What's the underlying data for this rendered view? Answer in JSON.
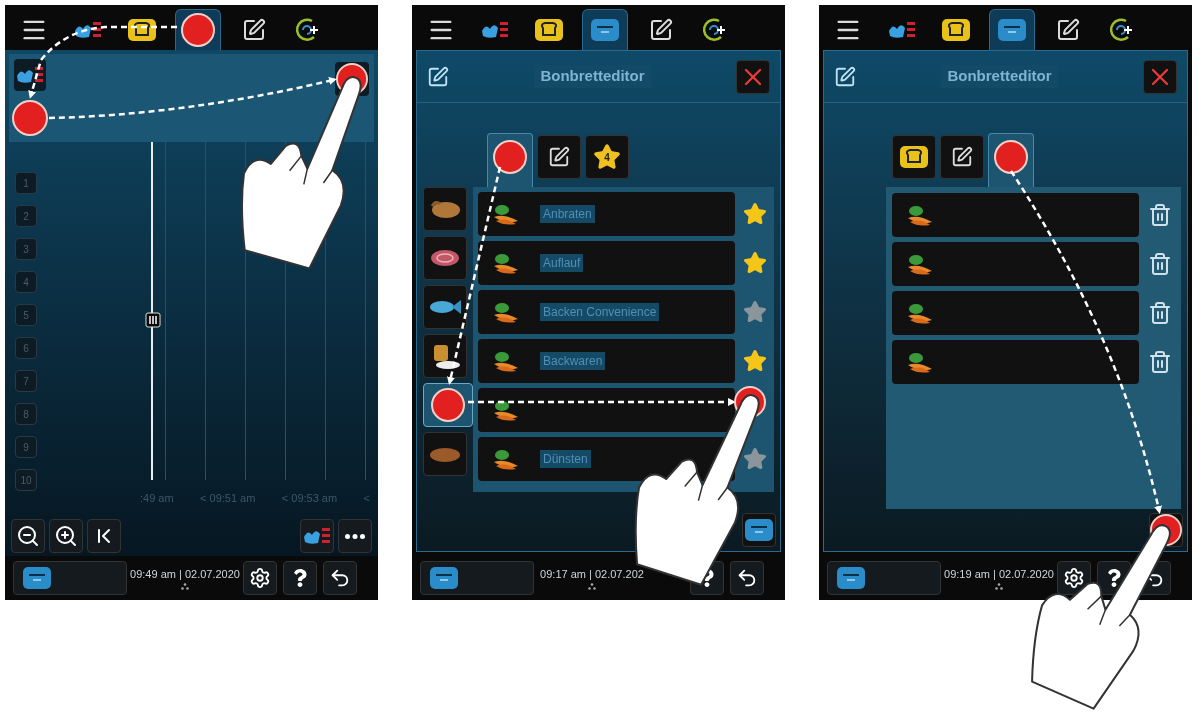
{
  "screens": [
    {
      "kind": "timeline",
      "top_tabs": [
        {
          "kind": "menu",
          "selected": false
        },
        {
          "kind": "pathway",
          "selected": false
        },
        {
          "kind": "bread",
          "selected": false
        },
        {
          "kind": "marked",
          "selected": true
        },
        {
          "kind": "edit",
          "selected": false
        },
        {
          "kind": "plus",
          "selected": false
        }
      ],
      "lanes": [
        "1",
        "2",
        "3",
        "4",
        "5",
        "6",
        "7",
        "8",
        "9",
        "10"
      ],
      "time_labels": [
        ":49 am",
        "< 09:51 am",
        "< 09:53 am",
        "<"
      ],
      "status": {
        "time": "09:49 am",
        "separator": "|",
        "date": "02.07.2020"
      }
    },
    {
      "kind": "editor",
      "top_tabs": [
        {
          "kind": "menu",
          "selected": false
        },
        {
          "kind": "pathway",
          "selected": false
        },
        {
          "kind": "bread",
          "selected": false
        },
        {
          "kind": "board",
          "selected": true
        },
        {
          "kind": "edit",
          "selected": false
        },
        {
          "kind": "plus",
          "selected": false
        }
      ],
      "title": "Bonbretteditor",
      "tabs": [
        {
          "kind": "marked",
          "selected": true
        },
        {
          "kind": "edit",
          "selected": false
        },
        {
          "kind": "favorites",
          "count": "4",
          "selected": false
        }
      ],
      "categories": [
        {
          "kind": "poultry",
          "selected": false
        },
        {
          "kind": "meat",
          "selected": false
        },
        {
          "kind": "fish",
          "selected": false
        },
        {
          "kind": "dessert",
          "selected": false
        },
        {
          "kind": "marked",
          "selected": true
        },
        {
          "kind": "bread",
          "selected": false
        }
      ],
      "rows": [
        {
          "label": "Anbraten",
          "favorite": true
        },
        {
          "label": "Auflauf",
          "favorite": true
        },
        {
          "label": "Backen Convenience",
          "favorite": false
        },
        {
          "label": "Backwaren",
          "favorite": true
        },
        {},
        {
          "label": "Dünsten",
          "favorite": false
        }
      ],
      "status": {
        "time": "09:17 am",
        "separator": "|",
        "date": "02.07.202"
      }
    },
    {
      "kind": "trash",
      "top_tabs": [
        {
          "kind": "menu",
          "selected": false
        },
        {
          "kind": "pathway",
          "selected": false
        },
        {
          "kind": "bread",
          "selected": false
        },
        {
          "kind": "board",
          "selected": true
        },
        {
          "kind": "edit",
          "selected": false
        },
        {
          "kind": "plus",
          "selected": false
        }
      ],
      "title": "Bonbretteditor",
      "tabs": [
        {
          "kind": "bread",
          "selected": false
        },
        {
          "kind": "edit",
          "selected": false
        },
        {
          "kind": "marked",
          "selected": true
        }
      ],
      "rows": [
        {
          "deletable": true
        },
        {
          "deletable": true
        },
        {
          "deletable": true
        },
        {
          "deletable": true
        }
      ],
      "status": {
        "time": "09:19 am",
        "separator": "|",
        "date": "02.07.2020"
      }
    }
  ]
}
